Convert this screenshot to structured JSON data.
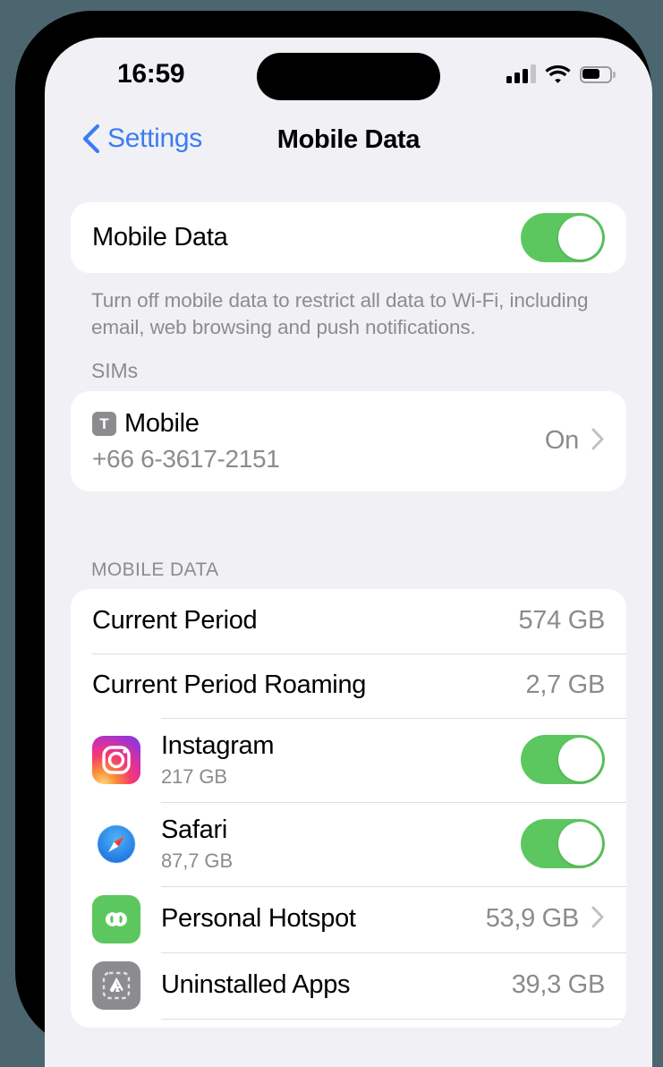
{
  "status_bar": {
    "time": "16:59",
    "signal_icon": "cellular-signal-icon",
    "wifi_icon": "wifi-icon",
    "battery_icon": "battery-icon"
  },
  "nav": {
    "back_label": "Settings",
    "title": "Mobile Data"
  },
  "mobile_data_toggle": {
    "label": "Mobile Data",
    "state": "on",
    "footer": "Turn off mobile data to restrict all data to Wi-Fi, including email, web browsing and push notifications."
  },
  "sims": {
    "header": "SIMs",
    "items": [
      {
        "badge": "T",
        "name": "Mobile",
        "number": "+66 6-3617-2151",
        "value": "On"
      }
    ]
  },
  "mobile_data_section": {
    "header": "MOBILE DATA",
    "usage_rows": [
      {
        "label": "Current Period",
        "value": "574 GB"
      },
      {
        "label": "Current Period Roaming",
        "value": "2,7 GB"
      }
    ],
    "app_rows": [
      {
        "name": "Instagram",
        "usage": "217 GB",
        "icon": "instagram-icon",
        "control": "toggle",
        "state": "on"
      },
      {
        "name": "Safari",
        "usage": "87,7 GB",
        "icon": "safari-icon",
        "control": "toggle",
        "state": "on"
      },
      {
        "name": "Personal Hotspot",
        "usage": "53,9 GB",
        "icon": "personal-hotspot-icon",
        "control": "chevron"
      },
      {
        "name": "Uninstalled Apps",
        "usage": "39,3 GB",
        "icon": "app-store-icon",
        "control": "none"
      }
    ]
  },
  "colors": {
    "accent_blue": "#3b7cf6",
    "toggle_green": "#5cc75f",
    "secondary_text": "#8b8b90",
    "page_background": "#f1f1f5",
    "card_background": "#ffffff",
    "outside_background": "#4c6670"
  }
}
